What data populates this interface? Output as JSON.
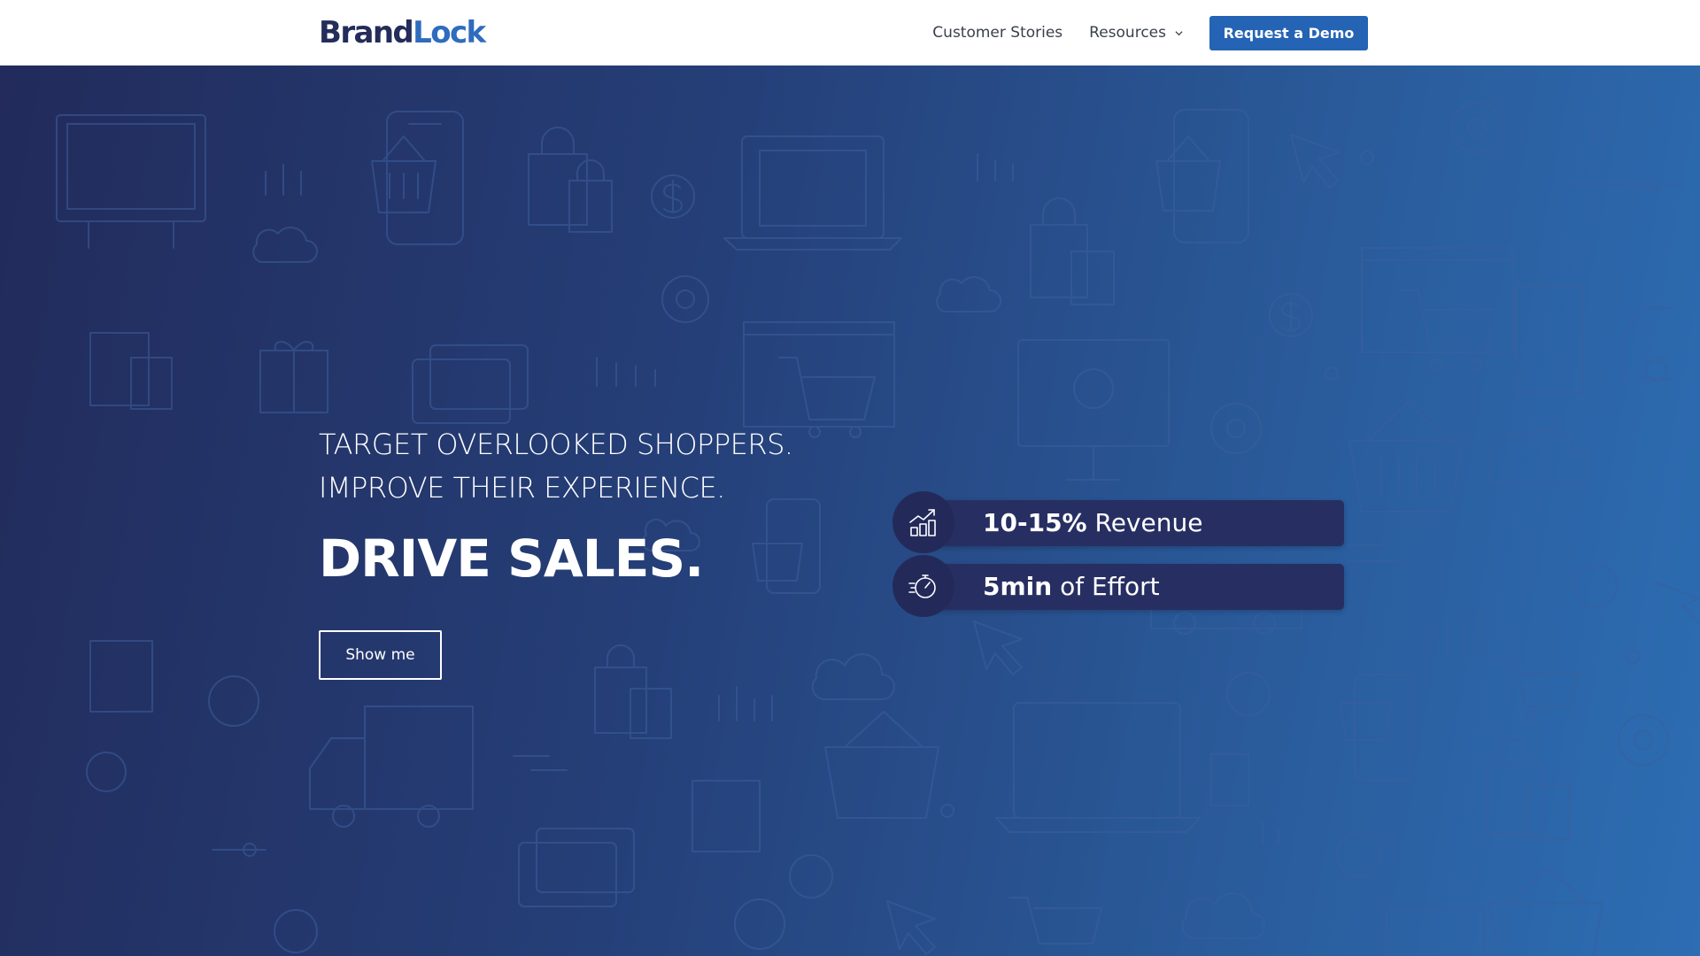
{
  "brand": {
    "name_part1": "Brand",
    "name_part2": "Lock"
  },
  "nav": {
    "customer_stories": "Customer Stories",
    "resources": "Resources",
    "request_demo": "Request a Demo"
  },
  "hero": {
    "line1": "TARGET OVERLOOKED SHOPPERS.",
    "line2": "IMPROVE THEIR EXPERIENCE.",
    "headline": "DRIVE SALES.",
    "cta": "Show me"
  },
  "stats": [
    {
      "value": "10-15%",
      "label": " Revenue",
      "icon": "revenue-growth-icon"
    },
    {
      "value": "5min",
      "label": " of Effort",
      "icon": "stopwatch-icon"
    }
  ],
  "colors": {
    "brand_dark": "#232c5a",
    "brand_blue": "#2f6cbd",
    "button_blue": "#2563b4",
    "stat_bar": "#272f62"
  },
  "background_icons": [
    "shopping-bag-icon",
    "shopping-cart-icon",
    "basket-icon",
    "dollar-icon",
    "gear-icon",
    "cloud-icon",
    "laptop-icon",
    "phone-icon",
    "cursor-icon",
    "gift-icon",
    "truck-icon",
    "credit-card-icon"
  ]
}
